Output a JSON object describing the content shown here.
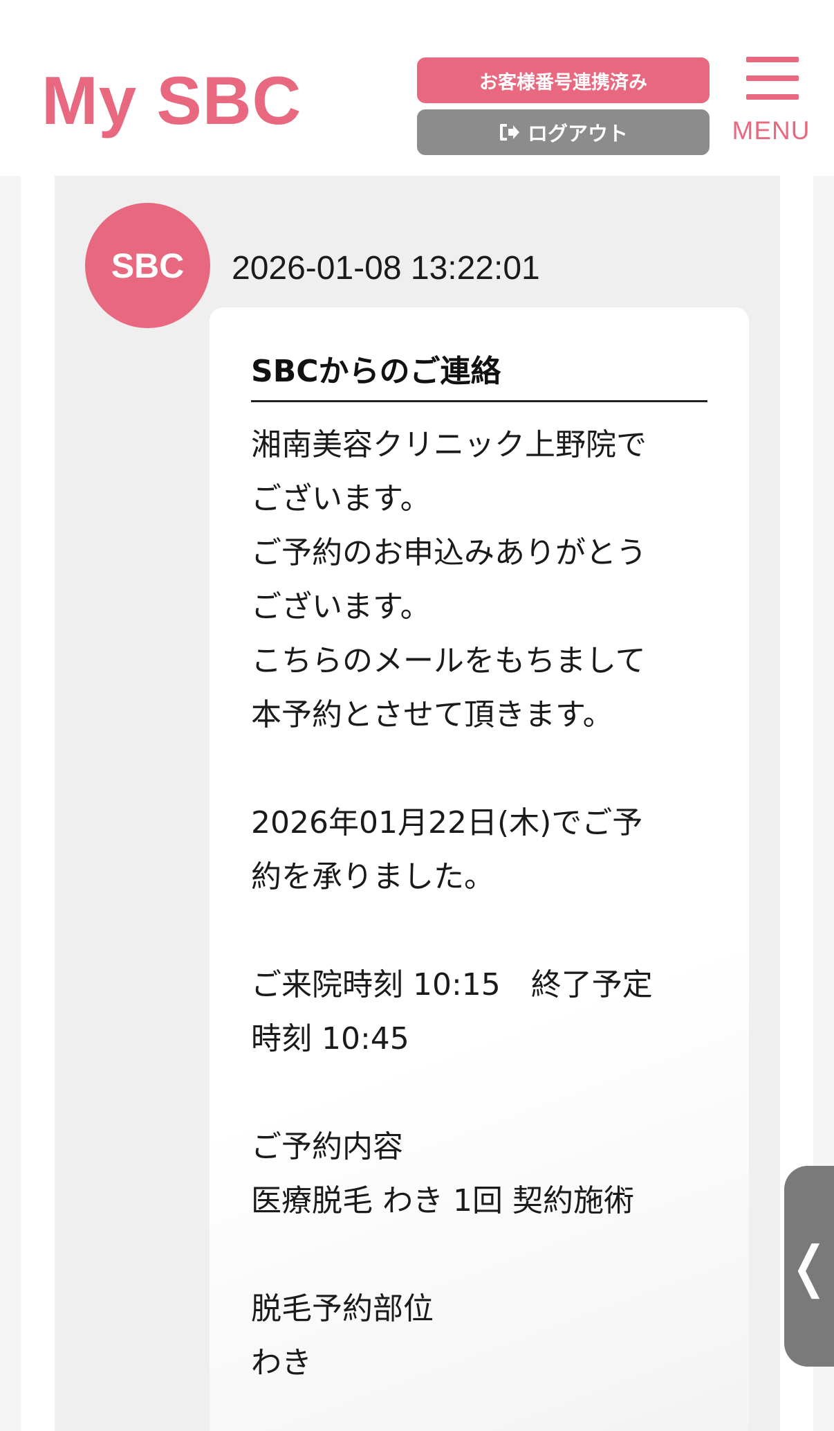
{
  "header": {
    "logo": "My SBC",
    "linked_button": "お客様番号連携済み",
    "logout_button": "ログアウト",
    "menu_label": "MENU"
  },
  "message": {
    "sender": "SBC",
    "timestamp": "2026-01-08 13:22:01",
    "title": "SBCからのご連絡",
    "lines": [
      "湘南美容クリニック上野院で",
      "ございます。",
      "ご予約のお申込みありがとう",
      "ございます。",
      "こちらのメールをもちまして",
      "本予約とさせて頂きます。",
      "",
      "2026年01月22日(木)でご予",
      "約を承りました。",
      "",
      "ご来院時刻 10:15　終了予定",
      "時刻 10:45",
      "",
      "ご予約内容",
      "医療脱毛 わき 1回 契約施術",
      "",
      "脱毛予約部位",
      "わき"
    ]
  },
  "icons": {
    "logout": "logout-icon",
    "menu": "hamburger-icon",
    "side_tab": "chevron-left-icon"
  },
  "colors": {
    "brand_pink": "#e8697f",
    "logout_gray": "#8c8c8c",
    "panel_bg": "#efefef"
  },
  "side_tab_glyph": "❬"
}
